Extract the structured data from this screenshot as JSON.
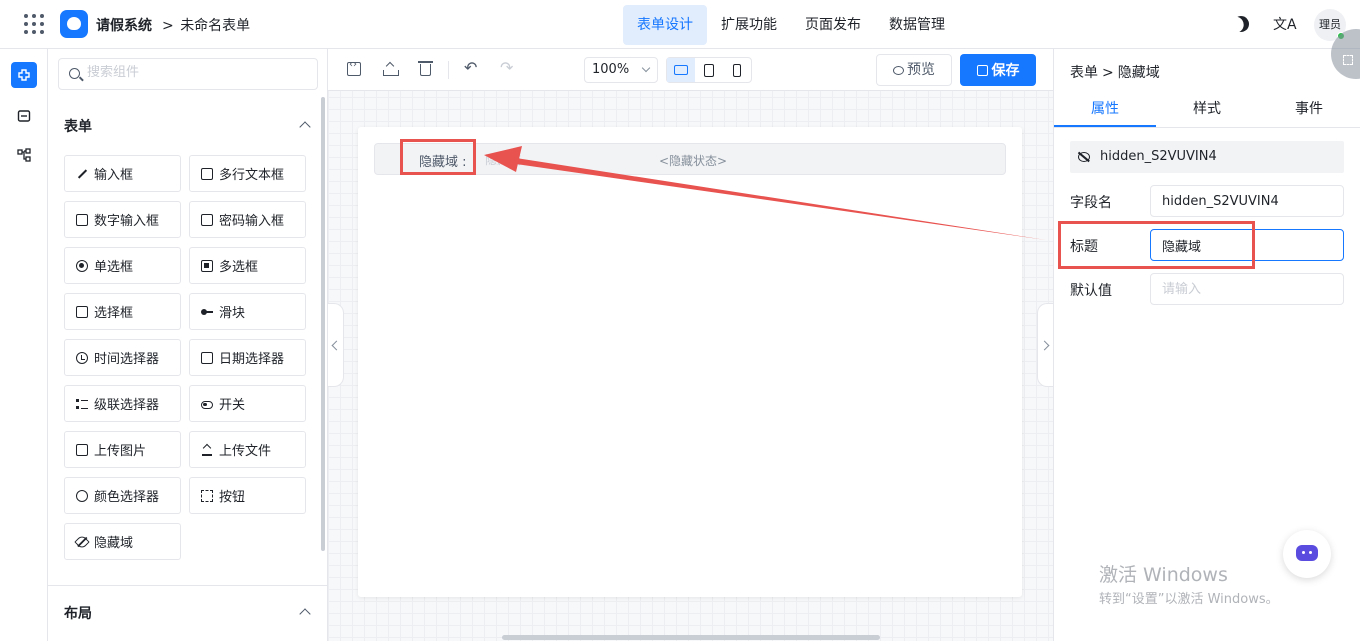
{
  "header": {
    "app_title": "请假系统",
    "breadcrumb_sep": ">",
    "breadcrumb_form": "未命名表单",
    "tabs": [
      {
        "label": "表单设计",
        "active": true
      },
      {
        "label": "扩展功能",
        "active": false
      },
      {
        "label": "页面发布",
        "active": false
      },
      {
        "label": "数据管理",
        "active": false
      }
    ],
    "lang_icon": "文A",
    "avatar_text": "理员",
    "accent_color": "#1677ff"
  },
  "left_rail": {
    "items": [
      {
        "name": "components-icon",
        "active": true
      },
      {
        "name": "template-icon",
        "active": false
      },
      {
        "name": "outline-icon",
        "active": false
      }
    ]
  },
  "component_panel": {
    "search_placeholder": "搜索组件",
    "form_section_title": "表单",
    "layout_section_title": "布局",
    "components": [
      {
        "label": "输入框",
        "icon": "pen-icon"
      },
      {
        "label": "多行文本框",
        "icon": "textarea-icon"
      },
      {
        "label": "数字输入框",
        "icon": "number-icon"
      },
      {
        "label": "密码输入框",
        "icon": "lock-icon"
      },
      {
        "label": "单选框",
        "icon": "radio-icon"
      },
      {
        "label": "多选框",
        "icon": "checkbox-icon"
      },
      {
        "label": "选择框",
        "icon": "select-icon"
      },
      {
        "label": "滑块",
        "icon": "slider-icon"
      },
      {
        "label": "时间选择器",
        "icon": "clock-icon"
      },
      {
        "label": "日期选择器",
        "icon": "calendar-icon"
      },
      {
        "label": "级联选择器",
        "icon": "cascader-icon"
      },
      {
        "label": "开关",
        "icon": "toggle-icon"
      },
      {
        "label": "上传图片",
        "icon": "image-icon"
      },
      {
        "label": "上传文件",
        "icon": "upload-icon"
      },
      {
        "label": "颜色选择器",
        "icon": "palette-icon"
      },
      {
        "label": "按钮",
        "icon": "button-icon"
      },
      {
        "label": "隐藏域",
        "icon": "eye-off-icon"
      }
    ]
  },
  "toolbar": {
    "zoom": "100%",
    "preview_label": "预览",
    "save_label": "保存"
  },
  "canvas": {
    "hidden_field_label": "隐藏域 :",
    "hidden_field_ghost": "隐藏域",
    "hidden_field_state": "<隐藏状态>"
  },
  "property_panel": {
    "breadcrumb_root": "表单",
    "breadcrumb_sep": ">",
    "breadcrumb_current": "隐藏域",
    "tabs": [
      {
        "label": "属性",
        "active": true
      },
      {
        "label": "样式",
        "active": false
      },
      {
        "label": "事件",
        "active": false
      }
    ],
    "field_id": "hidden_S2VUVIN4",
    "field_name_label": "字段名",
    "field_name_value": "hidden_S2VUVIN4",
    "title_label": "标题",
    "title_value": "隐藏域",
    "default_label": "默认值",
    "default_placeholder": "请输入"
  },
  "watermark": {
    "line1": "激活 Windows",
    "line2": "转到“设置”以激活 Windows。"
  },
  "annotation_color": "#e8524f"
}
